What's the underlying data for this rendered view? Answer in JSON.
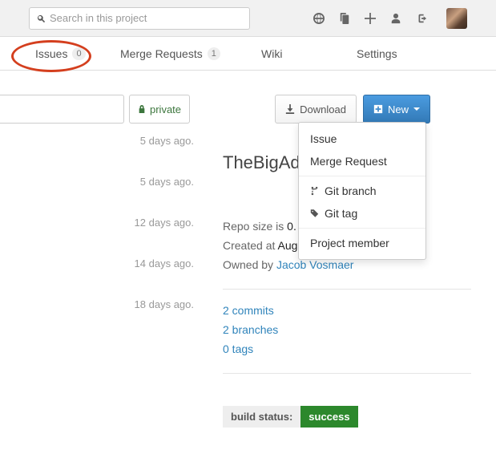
{
  "search": {
    "placeholder": "Search in this project"
  },
  "tabs": {
    "issues": {
      "label": "Issues",
      "count": "0"
    },
    "merge_requests": {
      "label": "Merge Requests",
      "count": "1"
    },
    "wiki": {
      "label": "Wiki"
    },
    "settings": {
      "label": "Settings"
    }
  },
  "toolbar": {
    "private": "private",
    "download": "Download",
    "new": "New"
  },
  "dropdown": {
    "issue": "Issue",
    "merge_request": "Merge Request",
    "git_branch": "Git branch",
    "git_tag": "Git tag",
    "project_member": "Project member"
  },
  "activity": [
    "5 days ago.",
    "5 days ago.",
    "12 days ago.",
    "14 days ago.",
    "18 days ago."
  ],
  "project": {
    "title": "TheBigAd",
    "repo_size_label": "Repo size is ",
    "repo_size_value": "0.",
    "created_label": "Created at ",
    "created_value": "Aug",
    "owned_label": "Owned by ",
    "owned_value": "Jacob Vosmaer",
    "commits": "2 commits",
    "branches": "2 branches",
    "tags": "0 tags",
    "build_label": "build status:",
    "build_value": "success"
  }
}
